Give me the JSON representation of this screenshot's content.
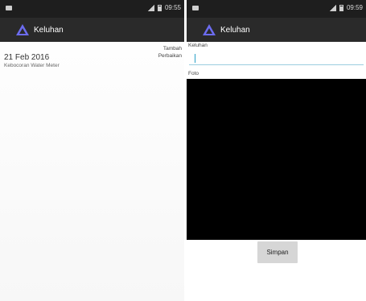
{
  "left_screen": {
    "status_time": "09:55",
    "app_title": "Keluhan",
    "add_action_label": "Tambah\nPerbaikan",
    "entries": [
      {
        "date": "21 Feb 2016",
        "description": "Kebocoran Water Meter"
      }
    ]
  },
  "right_screen": {
    "status_time": "09:59",
    "app_title": "Keluhan",
    "complaint_label": "Keluhan",
    "complaint_value": "",
    "photo_label": "Foto",
    "save_label": "Simpan"
  },
  "colors": {
    "statusbar": "#1e1e1e",
    "appbar": "#2a2a2a",
    "accent": "#2aa0c8",
    "logo": "#6c6cf0"
  },
  "icons": [
    "notification-icon",
    "signal-icon",
    "battery-icon",
    "app-logo-icon"
  ]
}
